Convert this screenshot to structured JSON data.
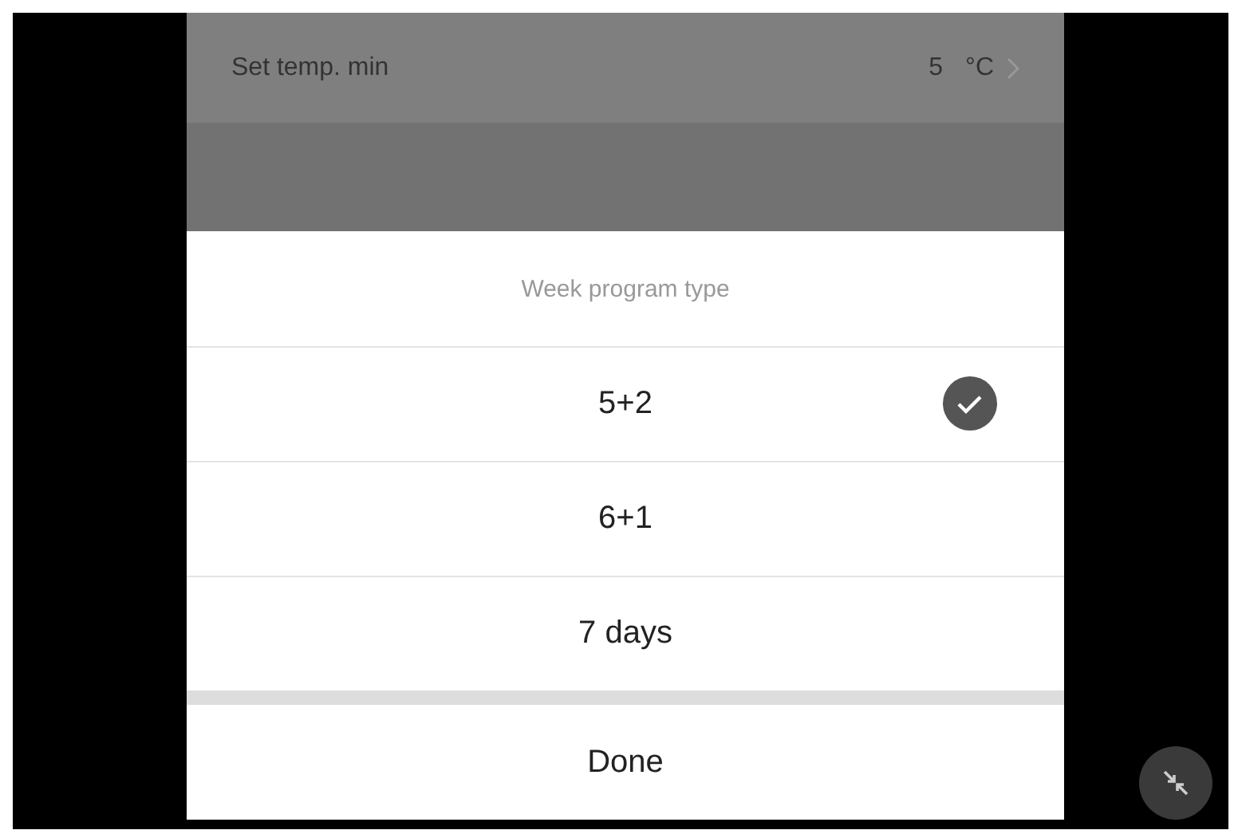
{
  "background_row": {
    "label": "Set temp. min",
    "value": "5",
    "unit": "°C"
  },
  "sheet": {
    "title": "Week program type",
    "options": [
      {
        "label": "5+2",
        "selected": true
      },
      {
        "label": "6+1",
        "selected": false
      },
      {
        "label": "7 days",
        "selected": false
      }
    ],
    "done_button": "Done"
  }
}
